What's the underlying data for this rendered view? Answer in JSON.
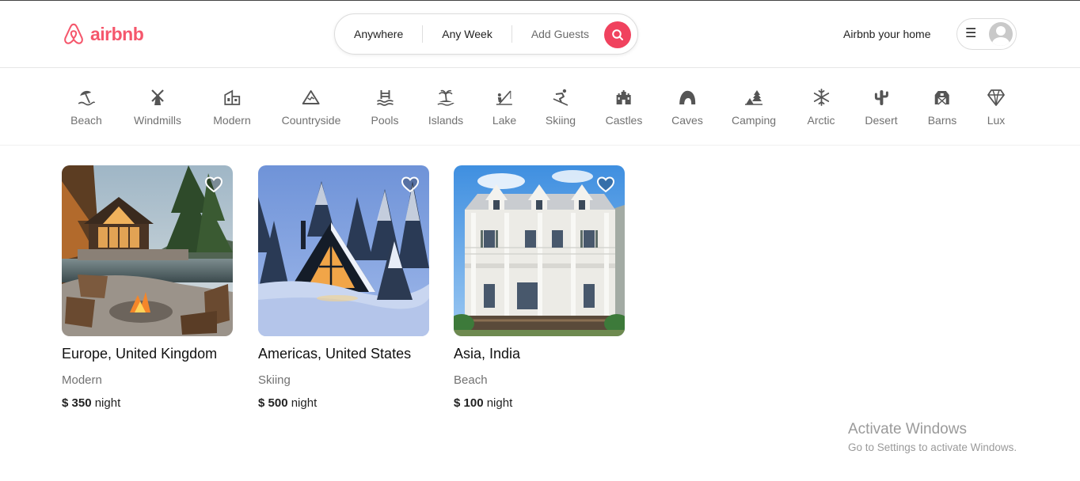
{
  "app": {
    "brand": "airbnb",
    "brand_color": "#f5576c"
  },
  "search": {
    "where": "Anywhere",
    "when": "Any Week",
    "guests": "Add Guests",
    "button_color": "#f0425e",
    "button_icon": "search-icon"
  },
  "header": {
    "host_link": "Airbnb your home",
    "menu_icon": "☰",
    "avatar_icon": "user-avatar-icon"
  },
  "categories": [
    {
      "label": "Beach",
      "icon": "beach-icon"
    },
    {
      "label": "Windmills",
      "icon": "windmill-icon"
    },
    {
      "label": "Modern",
      "icon": "modern-house-icon"
    },
    {
      "label": "Countryside",
      "icon": "mountain-icon"
    },
    {
      "label": "Pools",
      "icon": "pool-icon"
    },
    {
      "label": "Islands",
      "icon": "island-icon"
    },
    {
      "label": "Lake",
      "icon": "lake-icon"
    },
    {
      "label": "Skiing",
      "icon": "skiing-icon"
    },
    {
      "label": "Castles",
      "icon": "castle-icon"
    },
    {
      "label": "Caves",
      "icon": "cave-icon"
    },
    {
      "label": "Camping",
      "icon": "camping-icon"
    },
    {
      "label": "Arctic",
      "icon": "snowflake-icon"
    },
    {
      "label": "Desert",
      "icon": "cactus-icon"
    },
    {
      "label": "Barns",
      "icon": "barn-icon"
    },
    {
      "label": "Lux",
      "icon": "diamond-icon"
    }
  ],
  "listings": [
    {
      "title": "Europe, United Kingdom",
      "category": "Modern",
      "price": "$ 350",
      "unit": "night",
      "photo": "lake-cabin-photo"
    },
    {
      "title": "Americas, United States",
      "category": "Skiing",
      "price": "$ 500",
      "unit": "night",
      "photo": "snow-a-frame-photo"
    },
    {
      "title": "Asia, India",
      "category": "Beach",
      "price": "$ 100",
      "unit": "night",
      "photo": "colonial-house-photo"
    }
  ],
  "watermark": {
    "title": "Activate Windows",
    "subtitle": "Go to Settings to activate Windows."
  }
}
